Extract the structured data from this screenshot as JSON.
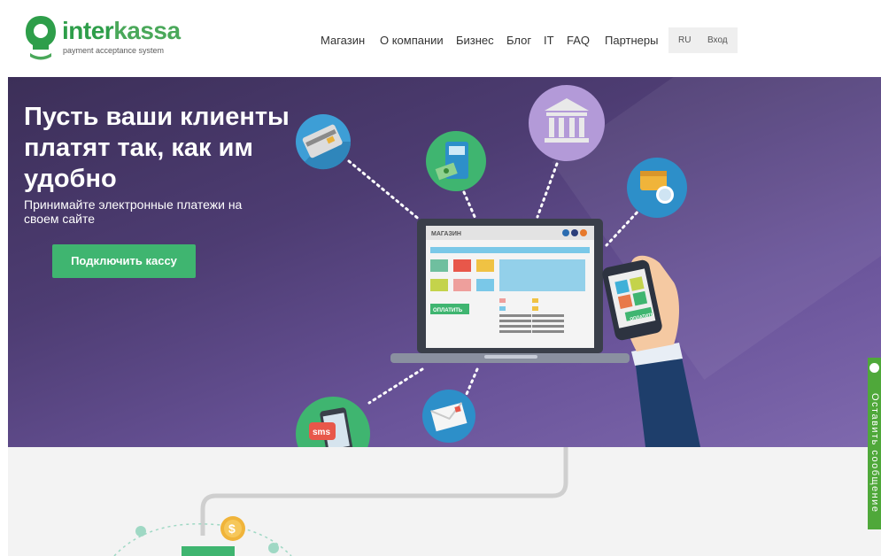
{
  "brand": {
    "name_part1": "inter",
    "name_part2": "kassa",
    "tagline": "payment acceptance system",
    "color_primary": "#2e9e4a"
  },
  "nav": {
    "items": [
      {
        "label": "Магазин"
      },
      {
        "label": "О компании"
      },
      {
        "label": "Бизнес"
      },
      {
        "label": "Блог"
      },
      {
        "label": "IT"
      },
      {
        "label": "FAQ"
      },
      {
        "label": "Партнеры"
      }
    ],
    "lang": "RU",
    "login": "Вход"
  },
  "hero": {
    "title": "Пусть ваши клиенты платят так, как им удобно",
    "subtitle": "Принимайте электронные платежи на своем сайте",
    "cta": "Подключить кассу",
    "bg_color": "#4d3c72",
    "cta_color": "#3fb570"
  },
  "illustration": {
    "laptop_header": "МАГАЗИН",
    "laptop_pay_button": "ОПЛАТИТЬ",
    "phone_pay_button": "ОПЛАТИТЬ",
    "sms_label": "sms",
    "icons": [
      "credit-card-icon",
      "atm-icon",
      "bank-icon",
      "wallet-icon",
      "sms-phone-icon",
      "mail-icon",
      "dollar-coin-icon"
    ]
  },
  "feedback": {
    "label": "Оставить сообщение",
    "color": "#4fa83a"
  }
}
